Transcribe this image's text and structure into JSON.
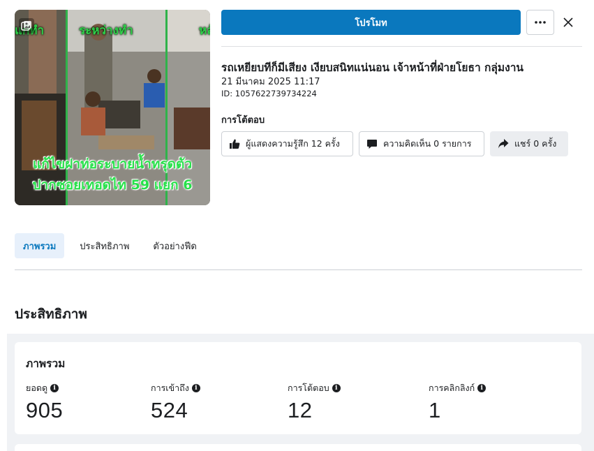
{
  "thumbnail": {
    "overlay_top": [
      "แก้ทำ",
      "ระหว่างทำ",
      "หลั"
    ],
    "caption_line1": "แก้ไขฝาท่อระบายน้ำทรุดตัว",
    "caption_line2": "ปากซอยเทอดไท 59 แยก 6",
    "icon": "photo-gallery-icon"
  },
  "header": {
    "promote_label": "โปรโมท",
    "more_icon": "more-horizontal-icon",
    "close_icon": "close-icon"
  },
  "post": {
    "title": "รถเหยียบทีก็มีเสียง เงียบสนิทแน่นอน เจ้าหน้าที่ฝ่ายโยธา กลุ่มงาน",
    "date": "21 มีนาคม 2025 11:17",
    "id": "ID: 1057622739734224"
  },
  "engagement": {
    "label": "การโต้ตอบ",
    "likes": "ผู้แสดงความรู้สึก 12 ครั้ง",
    "comments": "ความคิดเห็น 0 รายการ",
    "shares": "แชร์ 0 ครั้ง"
  },
  "tabs": [
    {
      "label": "ภาพรวม",
      "active": true
    },
    {
      "label": "ประสิทธิภาพ",
      "active": false
    },
    {
      "label": "ตัวอย่างฟีด",
      "active": false
    }
  ],
  "performance": {
    "section_title": "ประสิทธิภาพ",
    "card_title": "ภาพรวม",
    "metrics": [
      {
        "label": "ยอดดู",
        "value": "905"
      },
      {
        "label": "การเข้าถึง",
        "value": "524"
      },
      {
        "label": "การโต้ตอบ",
        "value": "12"
      },
      {
        "label": "การคลิกลิงก์",
        "value": "1"
      }
    ]
  },
  "colors": {
    "primary": "#0a78be",
    "tab_active_bg": "#e7f0fb",
    "page_gray": "#f0f2f5"
  }
}
